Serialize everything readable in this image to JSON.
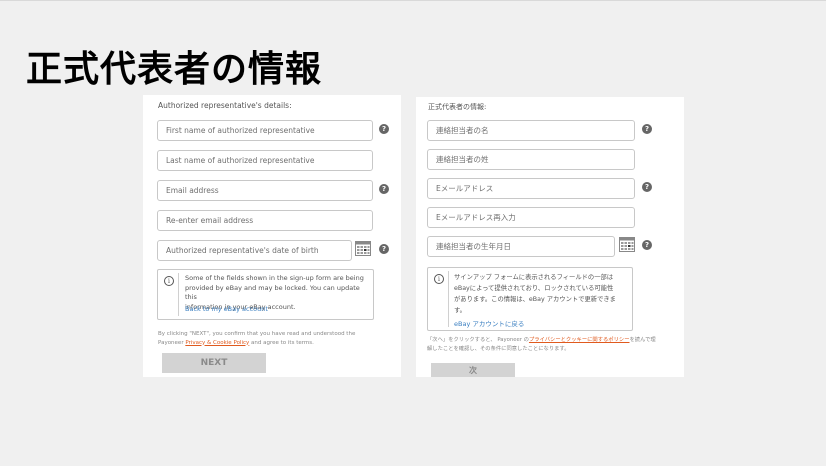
{
  "slide": {
    "title": "正式代表者の情報"
  },
  "en": {
    "heading": "Authorized representative's details:",
    "fields": {
      "first_name": "First name of authorized representative",
      "last_name": "Last name of authorized representative",
      "email": "Email address",
      "email_confirm": "Re-enter email address",
      "dob": "Authorized representative's date of birth"
    },
    "notice": {
      "lines": [
        "Some of the fields shown in the sign-up form are being",
        "provided by eBay and may be locked. You can update this",
        "information in your eBay account."
      ],
      "link": "Back to my eBay account"
    },
    "legal": {
      "line1": "By clicking \"NEXT\", you confirm that you have read and understood the",
      "line2_pre": "Payoneer ",
      "line2_link": "Privacy & Cookie Policy",
      "line2_post": " and agree to its terms."
    },
    "next_label": "NEXT"
  },
  "ja": {
    "heading": "正式代表者の情報:",
    "fields": {
      "first_name": "連絡担当者の名",
      "last_name": "連絡担当者の姓",
      "email": "Eメールアドレス",
      "email_confirm": "Eメールアドレス再入力",
      "dob": "連絡担当者の生年月日"
    },
    "notice": {
      "lines": [
        "サインアップ フォームに表示されるフィールドの一部は",
        "eBayによって提供されており、ロックされている可能性",
        "があります。この情報は、eBay アカウントで更新できま",
        "す。"
      ],
      "link": "eBay アカウントに戻る"
    },
    "legal": {
      "line1_pre": "「次へ」をクリックすると、 Payoneer の",
      "line1_link": "プライバシーとクッキーに関するポリシー",
      "line1_post": "を読んで理",
      "line2": "解したことを確認し、その条件に同意したことになります。"
    },
    "next_label": "次"
  },
  "icons": {
    "help": "question-mark-icon",
    "calendar": "calendar-icon",
    "info": "info-icon"
  }
}
